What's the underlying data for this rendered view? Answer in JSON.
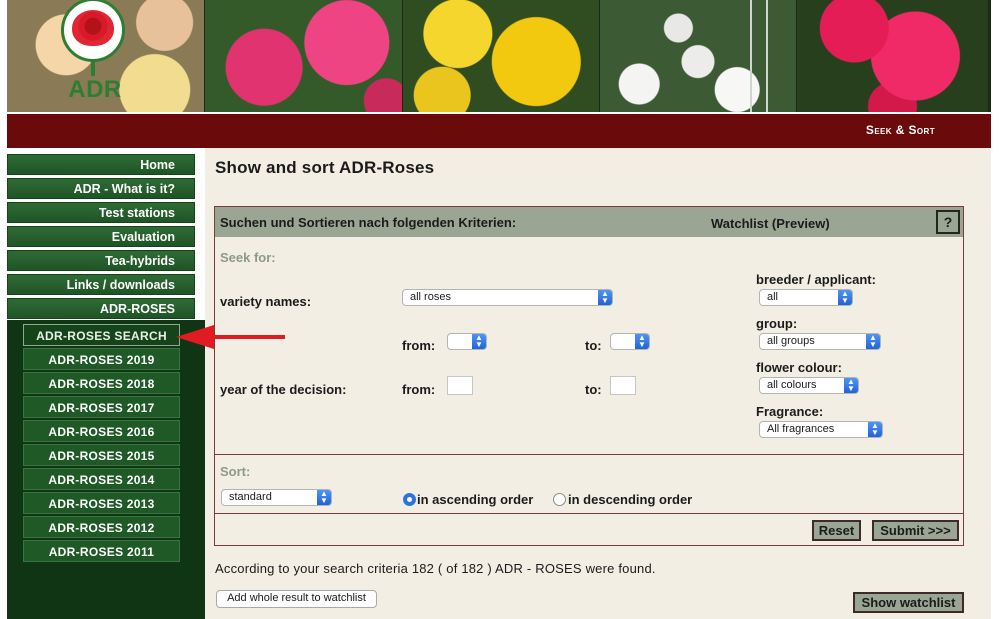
{
  "logo": {
    "text": "ADR"
  },
  "topbar": {
    "title": "Seek & Sort"
  },
  "nav": {
    "items": [
      {
        "label": "Home"
      },
      {
        "label": "ADR - What is it?"
      },
      {
        "label": "Test stations"
      },
      {
        "label": "Evaluation"
      },
      {
        "label": "Tea-hybrids"
      },
      {
        "label": "Links / downloads"
      },
      {
        "label": "ADR-ROSES"
      }
    ],
    "subitems": [
      {
        "label": "ADR-ROSES SEARCH",
        "active": true
      },
      {
        "label": "ADR-ROSES 2019"
      },
      {
        "label": "ADR-ROSES 2018"
      },
      {
        "label": "ADR-ROSES 2017"
      },
      {
        "label": "ADR-ROSES 2016"
      },
      {
        "label": "ADR-ROSES 2015"
      },
      {
        "label": "ADR-ROSES 2014"
      },
      {
        "label": "ADR-ROSES 2013"
      },
      {
        "label": "ADR-ROSES 2012"
      },
      {
        "label": "ADR-ROSES 2011"
      }
    ]
  },
  "main": {
    "title": "Show and sort ADR-Roses",
    "panel": {
      "head_left": "Suchen und Sortieren nach folgenden Kriterien:",
      "head_right": "Watchlist (Preview)",
      "help": "?",
      "seek_for": "Seek for:",
      "variety_names_label": "variety names:",
      "variety_select": "all roses",
      "from_label": "from:",
      "to_label": "to:",
      "year_label": "year of the decision:",
      "breeder_label": "breeder / applicant:",
      "breeder_select": "all",
      "group_label": "group:",
      "group_select": "all groups",
      "colour_label": "flower colour:",
      "colour_select": "all colours",
      "fragrance_label": "Fragrance:",
      "fragrance_select": "All fragrances",
      "sort_label": "Sort:",
      "sort_select": "standard",
      "asc_label": "in ascending order",
      "desc_label": "in descending order",
      "reset": "Reset",
      "submit": "Submit >>>"
    },
    "result_text": "According to your search criteria 182 ( of 182 ) ADR - ROSES were found.",
    "add_watchlist": "Add whole result to watchlist",
    "show_watchlist": "Show watchlist"
  },
  "colors": {
    "maroon": "#6a0a0a",
    "nav_green": "#1f5526",
    "panel_head": "#9aa693",
    "accent_red_arrow": "#e01b22"
  }
}
